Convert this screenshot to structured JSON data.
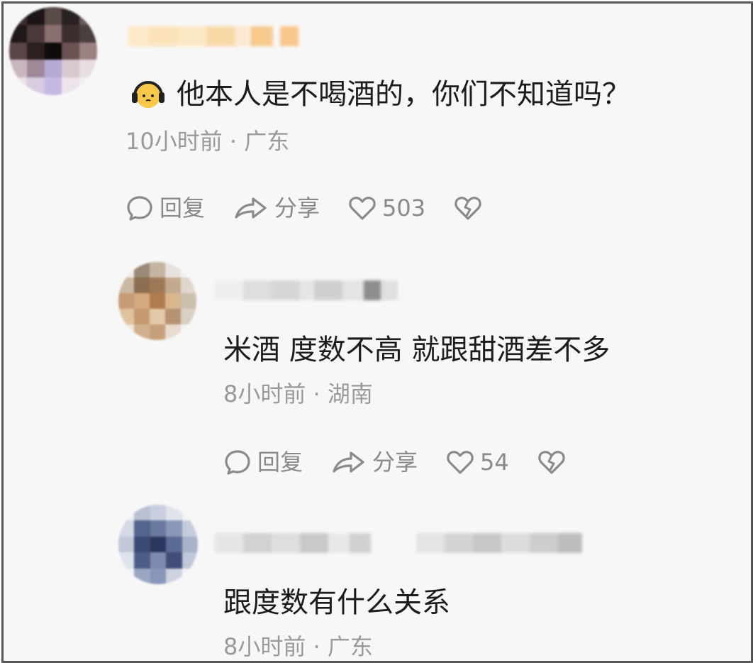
{
  "comments": [
    {
      "text": "他本人是不喝酒的，你们不知道吗？",
      "meta": "10小时前 · 广东",
      "reply_label": "回复",
      "share_label": "分享",
      "like_count": "503",
      "icons": [
        "emoji-headphones-icon",
        "reply-bubble-icon",
        "share-arrow-icon",
        "heart-icon",
        "broken-heart-icon"
      ]
    },
    {
      "text": "米酒 度数不高  就跟甜酒差不多",
      "meta": "8小时前 · 湖南",
      "reply_label": "回复",
      "share_label": "分享",
      "like_count": "54"
    },
    {
      "text": "跟度数有什么关系",
      "meta": "8小时前 · 广东"
    }
  ],
  "colors": {
    "text": "#1c1c1c",
    "meta": "#9a9a9a",
    "action": "#8a8a8a",
    "background": "#f7f7f7"
  }
}
